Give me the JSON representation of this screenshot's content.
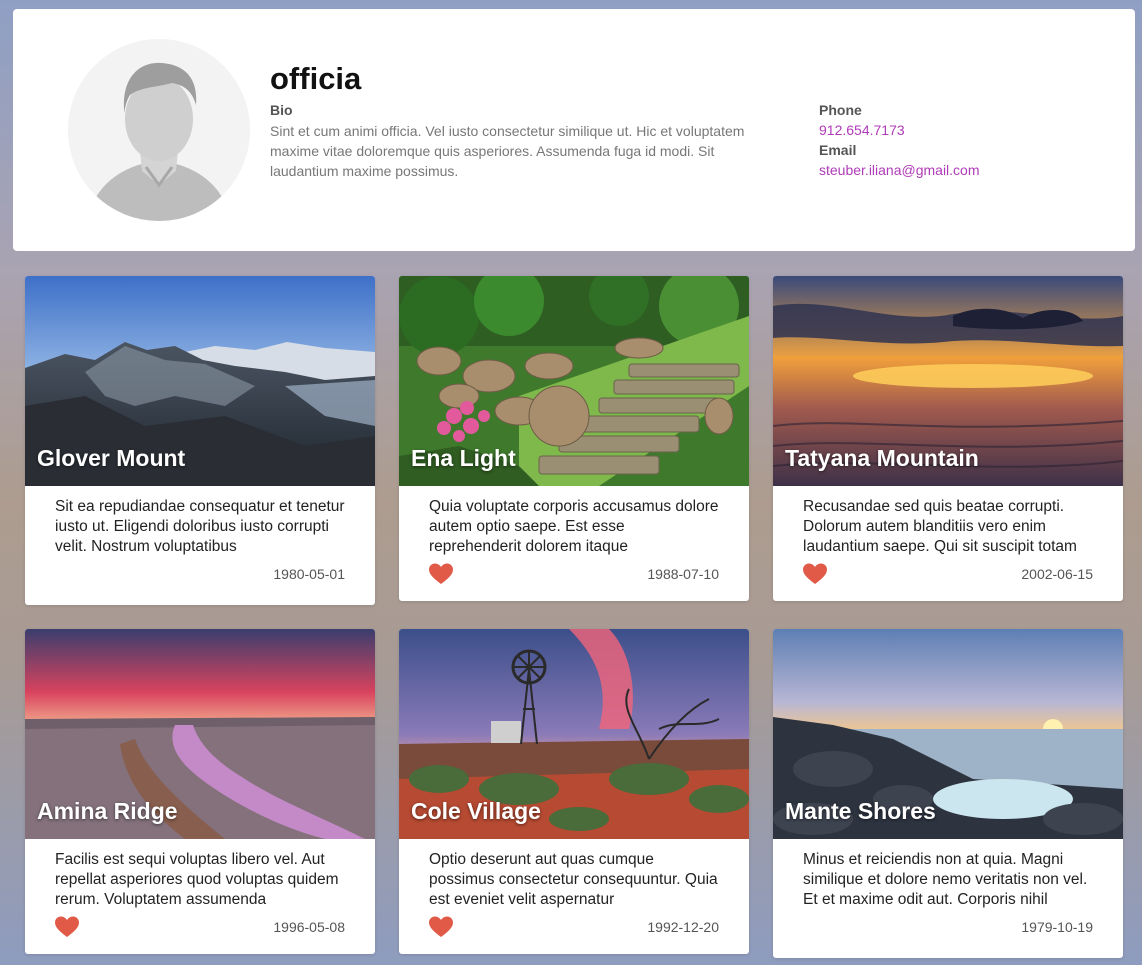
{
  "profile": {
    "name": "officia",
    "bio_label": "Bio",
    "bio_text": "Sint et cum animi officia. Vel iusto consectetur similique ut. Hic et voluptatem maxime vitae doloremque quis asperiores. Assumenda fuga id modi. Sit laudantium maxime possimus.",
    "phone_label": "Phone",
    "phone": "912.654.7173",
    "email_label": "Email",
    "email": "steuber.iliana@gmail.com",
    "avatar_icon": "person-silhouette-icon"
  },
  "colors": {
    "link": "#b03bb8",
    "heart": "#e05a47"
  },
  "cards": [
    {
      "title": "Glover Mount",
      "description": "Sit ea repudiandae consequatur et tenetur iusto ut. Eligendi doloribus iusto corrupti velit. Nostrum voluptatibus",
      "date": "1980-05-01",
      "liked": false,
      "image": "mountain-landscape"
    },
    {
      "title": "Ena Light",
      "description": "Quia voluptate corporis accusamus dolore autem optio saepe. Est esse reprehenderit dolorem itaque",
      "date": "1988-07-10",
      "liked": true,
      "image": "garden-stone-steps"
    },
    {
      "title": "Tatyana Mountain",
      "description": "Recusandae sed quis beatae corrupti. Dolorum autem blanditiis vero enim laudantium saepe. Qui sit suscipit totam",
      "date": "2002-06-15",
      "liked": true,
      "image": "sunset-beach"
    },
    {
      "title": "Amina Ridge",
      "description": "Facilis est sequi voluptas libero vel. Aut repellat asperiores quod voluptas quidem rerum. Voluptatem assumenda",
      "date": "1996-05-08",
      "liked": true,
      "image": "river-sunset"
    },
    {
      "title": "Cole Village",
      "description": "Optio deserunt aut quas cumque possimus consectetur consequuntur. Quia est eveniet velit aspernatur",
      "date": "1992-12-20",
      "liked": true,
      "image": "windmill-outback"
    },
    {
      "title": "Mante Shores",
      "description": "Minus et reiciendis non at quia. Magni similique et dolore nemo veritatis non vel. Et et maxime odit aut. Corporis nihil",
      "date": "1979-10-19",
      "liked": false,
      "image": "rocky-shore-sunset"
    }
  ]
}
